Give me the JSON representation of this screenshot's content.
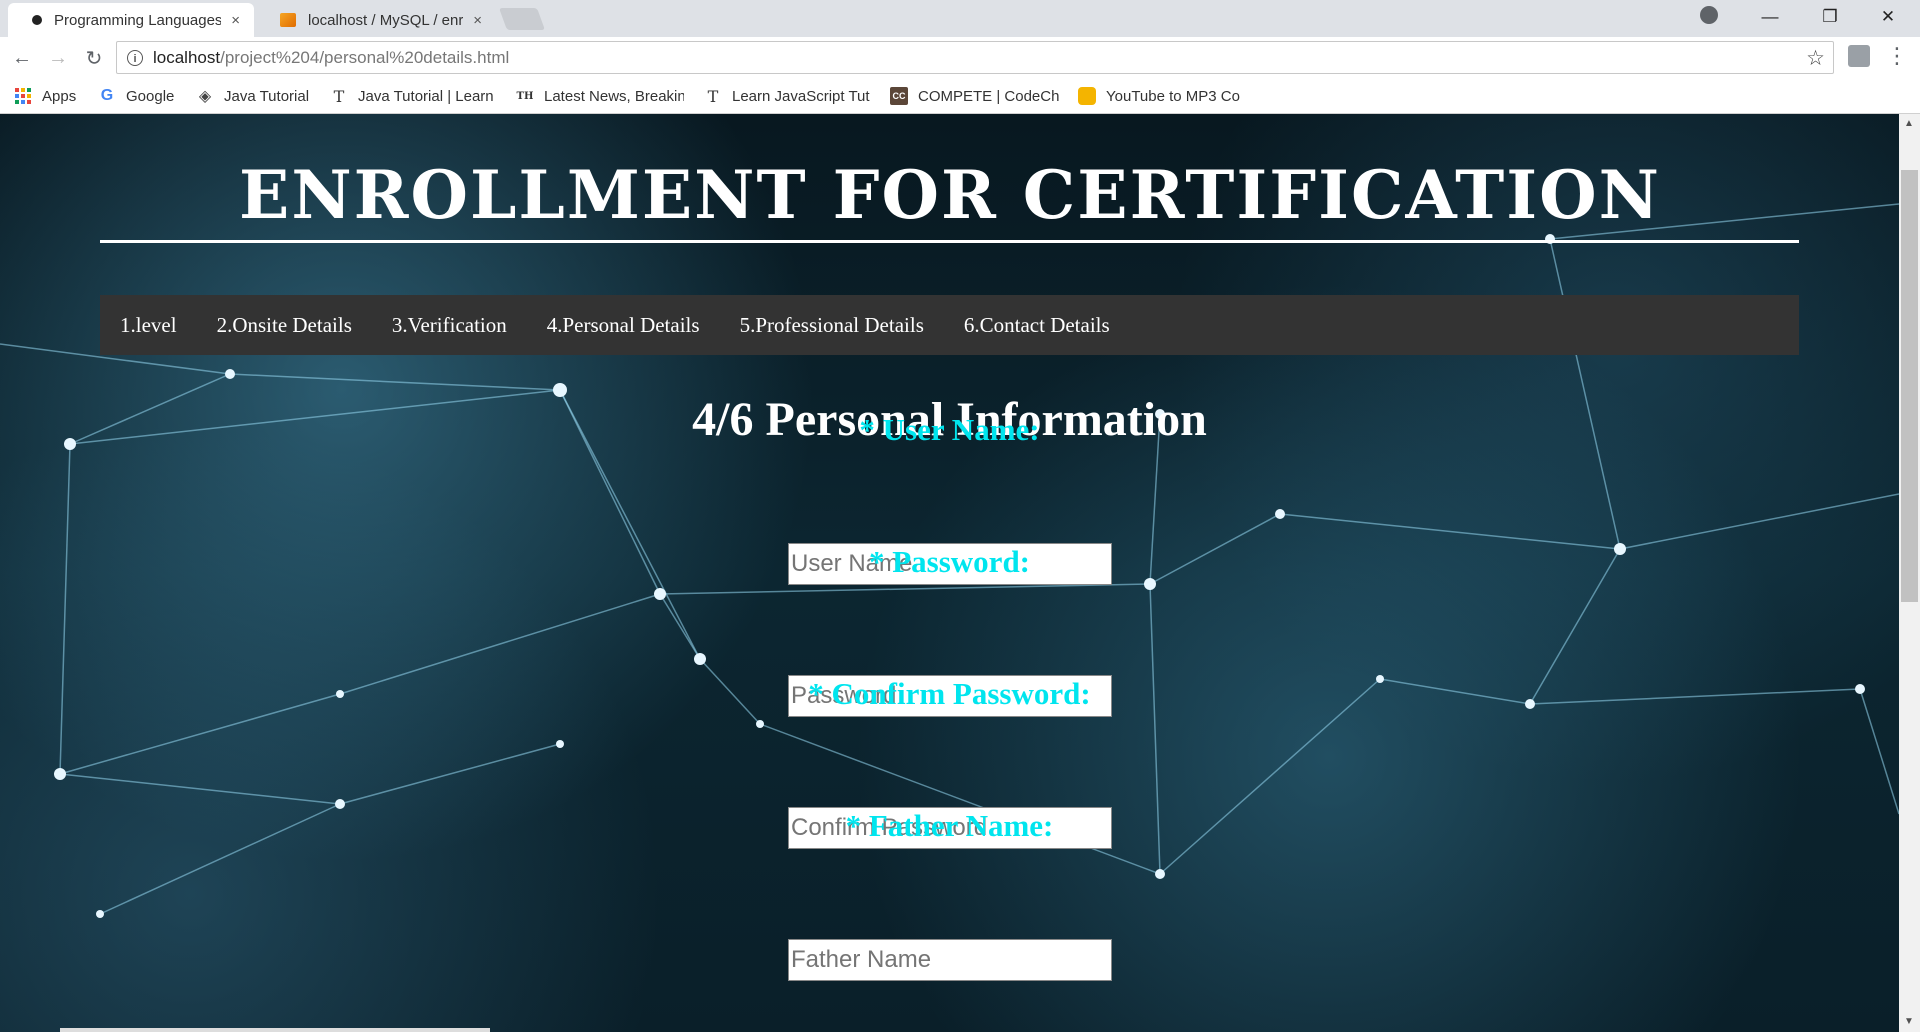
{
  "browser": {
    "tabs": [
      {
        "label": "Programming Languages",
        "active": true
      },
      {
        "label": "localhost / MySQL / enro",
        "active": false
      }
    ],
    "close_glyph": "×",
    "window_controls": {
      "minimize": "—",
      "restore": "❐",
      "close": "✕"
    },
    "nav": {
      "back": "←",
      "forward": "→",
      "reload": "↻"
    },
    "url_host": "localhost",
    "url_path": "/project%204/personal%20details.html",
    "star_glyph": "☆",
    "menu_glyph": "⋮",
    "bookmarks": [
      {
        "label": "Apps",
        "icon": "apps-grid-icon"
      },
      {
        "label": "Google",
        "icon": "google-g-icon"
      },
      {
        "label": "Java Tutorial",
        "icon": "java-tutorial-icon"
      },
      {
        "label": "Java Tutorial | Learn",
        "icon": "t-letter-icon"
      },
      {
        "label": "Latest News, Breakin",
        "icon": "th-letters-icon"
      },
      {
        "label": "Learn JavaScript Tut",
        "icon": "t-letter-icon"
      },
      {
        "label": "COMPETE | CodeChe",
        "icon": "codechef-cc-icon"
      },
      {
        "label": "YouTube to MP3 Co",
        "icon": "yt-mp3-icon"
      }
    ]
  },
  "page": {
    "heading": "ENROLLMENT FOR CERTIFICATION",
    "nav_items": [
      "1.level",
      "2.Onsite Details",
      "3.Verification",
      "4.Personal Details",
      "5.Professional Details",
      "6.Contact Details"
    ],
    "form_title": "4/6 Personal Information",
    "fields": [
      {
        "label": "* User Name:",
        "placeholder": "User Name"
      },
      {
        "label": "* Password:",
        "placeholder": "Password"
      },
      {
        "label": "* Confirm Password:",
        "placeholder": "Confirm Password"
      },
      {
        "label": "* Father Name:",
        "placeholder": "Father Name"
      }
    ],
    "colors": {
      "label": "#00e5ee",
      "navbar": "#333333",
      "text": "#ffffff"
    }
  }
}
